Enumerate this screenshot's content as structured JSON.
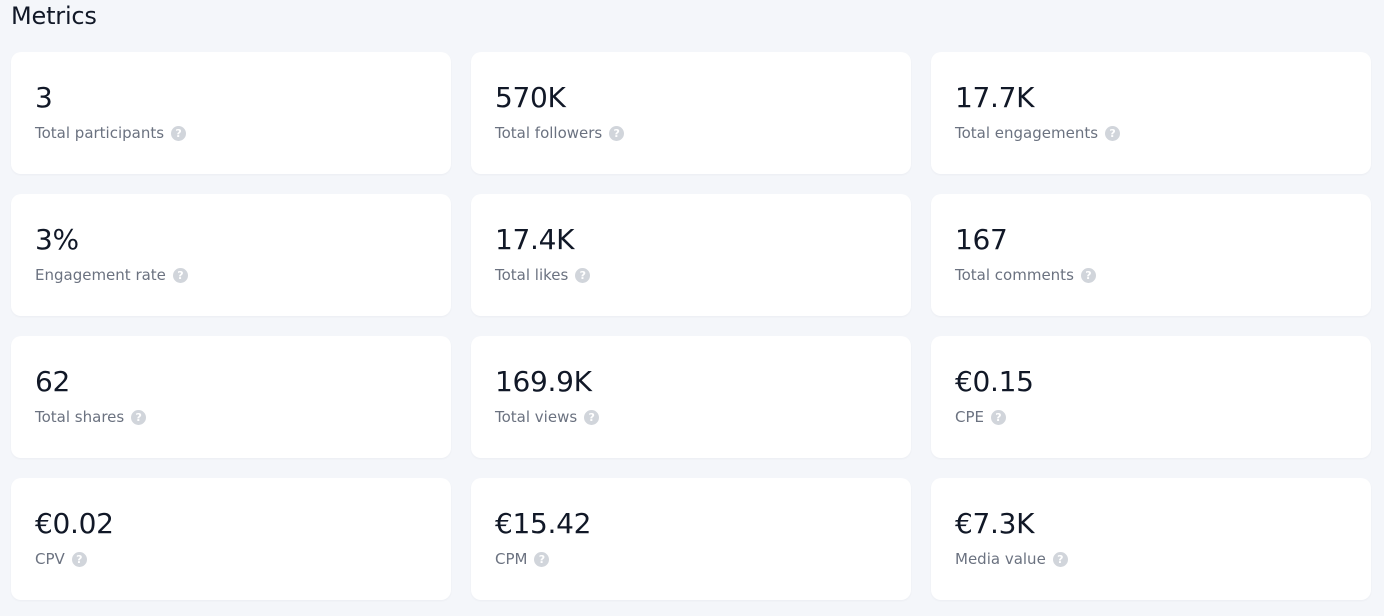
{
  "page": {
    "title": "Metrics"
  },
  "help_icon": {
    "glyph": "?",
    "name": "help-icon"
  },
  "metrics": [
    {
      "id": "total-participants",
      "value": "3",
      "label": "Total participants"
    },
    {
      "id": "total-followers",
      "value": "570K",
      "label": "Total followers"
    },
    {
      "id": "total-engagements",
      "value": "17.7K",
      "label": "Total engagements"
    },
    {
      "id": "engagement-rate",
      "value": "3%",
      "label": "Engagement rate"
    },
    {
      "id": "total-likes",
      "value": "17.4K",
      "label": "Total likes"
    },
    {
      "id": "total-comments",
      "value": "167",
      "label": "Total comments"
    },
    {
      "id": "total-shares",
      "value": "62",
      "label": "Total shares"
    },
    {
      "id": "total-views",
      "value": "169.9K",
      "label": "Total views"
    },
    {
      "id": "cpe",
      "value": "€0.15",
      "label": "CPE"
    },
    {
      "id": "cpv",
      "value": "€0.02",
      "label": "CPV"
    },
    {
      "id": "cpm",
      "value": "€15.42",
      "label": "CPM"
    },
    {
      "id": "media-value",
      "value": "€7.3K",
      "label": "Media value"
    }
  ]
}
